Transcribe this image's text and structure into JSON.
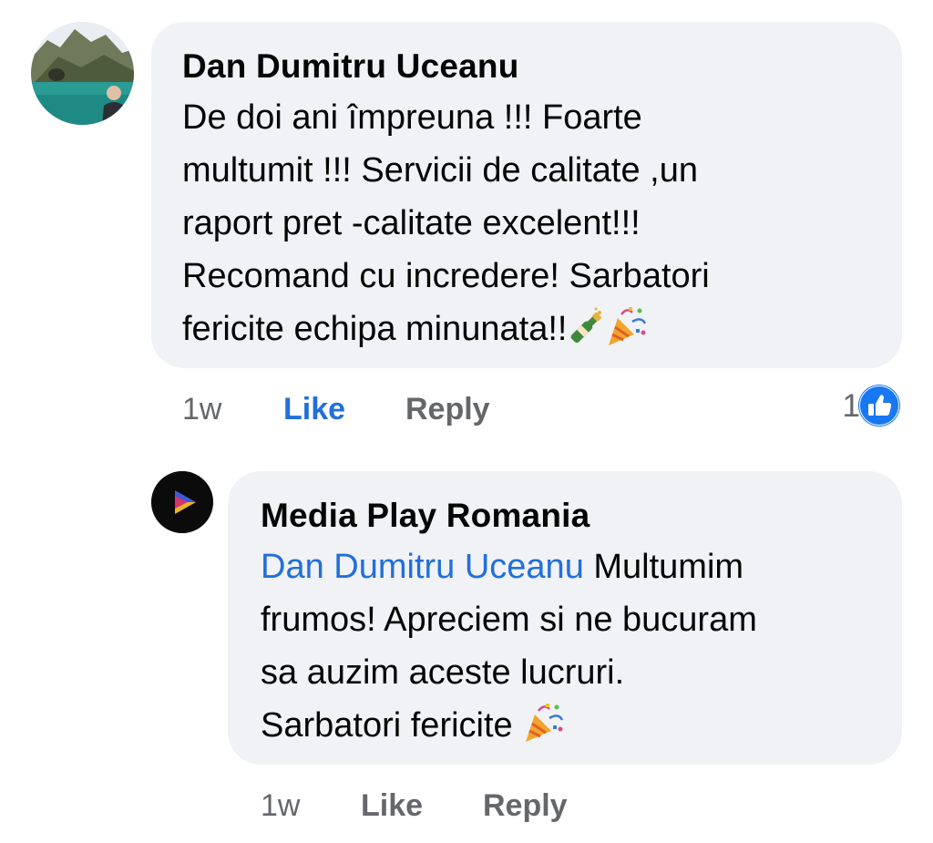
{
  "comment": {
    "author": "Dan Dumitru Uceanu",
    "text_lines": [
      "De doi ani împreuna !!! Foarte",
      "multumit !!! Servicii de calitate ,un",
      "raport pret -calitate excelent!!!",
      "Recomand cu incredere! Sarbatori",
      "fericite echipa minunata!!"
    ],
    "emojis": [
      "champagne-bottle-icon",
      "party-popper-icon"
    ],
    "time": "1w",
    "like_label": "Like",
    "reply_label": "Reply",
    "reaction_count": "1",
    "like_active": true
  },
  "reply": {
    "author": "Media Play Romania",
    "mention": "Dan Dumitru Uceanu",
    "text_lines": [
      " Multumim",
      "frumos! Apreciem si ne bucuram",
      "sa auzim aceste lucruri.",
      "Sarbatori fericite "
    ],
    "emojis": [
      "party-popper-icon"
    ],
    "time": "1w",
    "like_label": "Like",
    "reply_label": "Reply"
  },
  "colors": {
    "bubble": "#f0f2f5",
    "link_blue": "#216fdb",
    "meta_gray": "#65676b",
    "like_badge": "#1877f2"
  }
}
